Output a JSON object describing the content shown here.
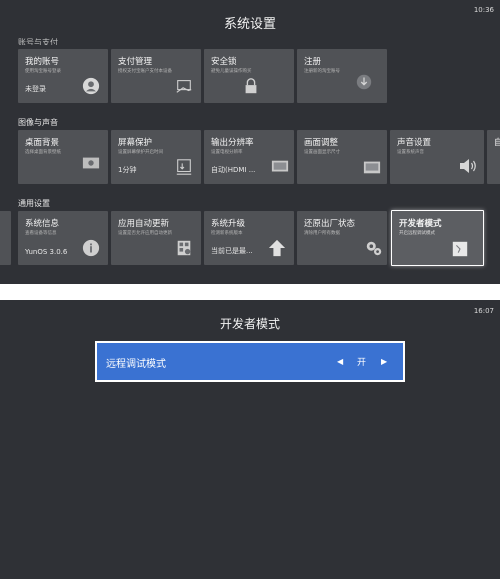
{
  "settings": {
    "title": "系统设置",
    "time": "10:36",
    "account_section": "账号与支付",
    "account_tiles": [
      {
        "title": "我的账号",
        "sub": "使用淘宝账号登录",
        "value": "未登录",
        "icon": "user-avatar-icon"
      },
      {
        "title": "支付管理",
        "sub": "授权支付宝账户支付本设备",
        "value": "",
        "icon": "payment-hand-icon"
      },
      {
        "title": "安全锁",
        "sub": "避免儿童误操作购买",
        "value": "",
        "icon": "lock-icon"
      },
      {
        "title": "注册",
        "sub": "注册新的淘宝账号",
        "value": "",
        "icon": "register-icon"
      }
    ],
    "display_section": "图像与声音",
    "display_tiles": [
      {
        "title": "桌面背景",
        "sub": "选择桌面背景壁纸",
        "value": "",
        "icon": "wallpaper-icon"
      },
      {
        "title": "屏幕保护",
        "sub": "设置屏幕保护开启时间",
        "value": "1分钟",
        "icon": "hand-timer-icon"
      },
      {
        "title": "输出分辨率",
        "sub": "设置电视分辨率",
        "value": "自动(HDMI ...",
        "icon": "monitor-icon"
      },
      {
        "title": "画面调整",
        "sub": "设置画面显示尺寸",
        "value": "",
        "icon": "screen-adjust-icon"
      },
      {
        "title": "声音设置",
        "sub": "设置系统声音",
        "value": "",
        "icon": "speaker-icon"
      },
      {
        "title": "自",
        "sub": "",
        "value": "",
        "icon": ""
      }
    ],
    "general_section": "通用设置",
    "general_tiles": [
      {
        "title": "系统信息",
        "sub": "查看设备等信息",
        "value": "YunOS 3.0.6",
        "icon": "info-icon"
      },
      {
        "title": "应用自动更新",
        "sub": "设置是否允许应用自动更新",
        "value": "",
        "icon": "app-update-icon"
      },
      {
        "title": "系统升级",
        "sub": "检测新系统版本",
        "value": "当前已是最...",
        "icon": "upgrade-arrow-icon"
      },
      {
        "title": "还原出厂状态",
        "sub": "清除用户所有数据",
        "value": "",
        "icon": "gears-icon"
      },
      {
        "title": "开发者模式",
        "sub": "开启远程调试模式",
        "value": "",
        "icon": "developer-icon"
      }
    ]
  },
  "developer": {
    "title": "开发者模式",
    "time": "16:07",
    "option_label": "远程调试模式",
    "option_value": "开",
    "prev_symbol": "◀",
    "next_symbol": "▶"
  },
  "colors": {
    "background": "#2f3136",
    "tile": "#505256",
    "selected_option": "#3a72d2"
  }
}
